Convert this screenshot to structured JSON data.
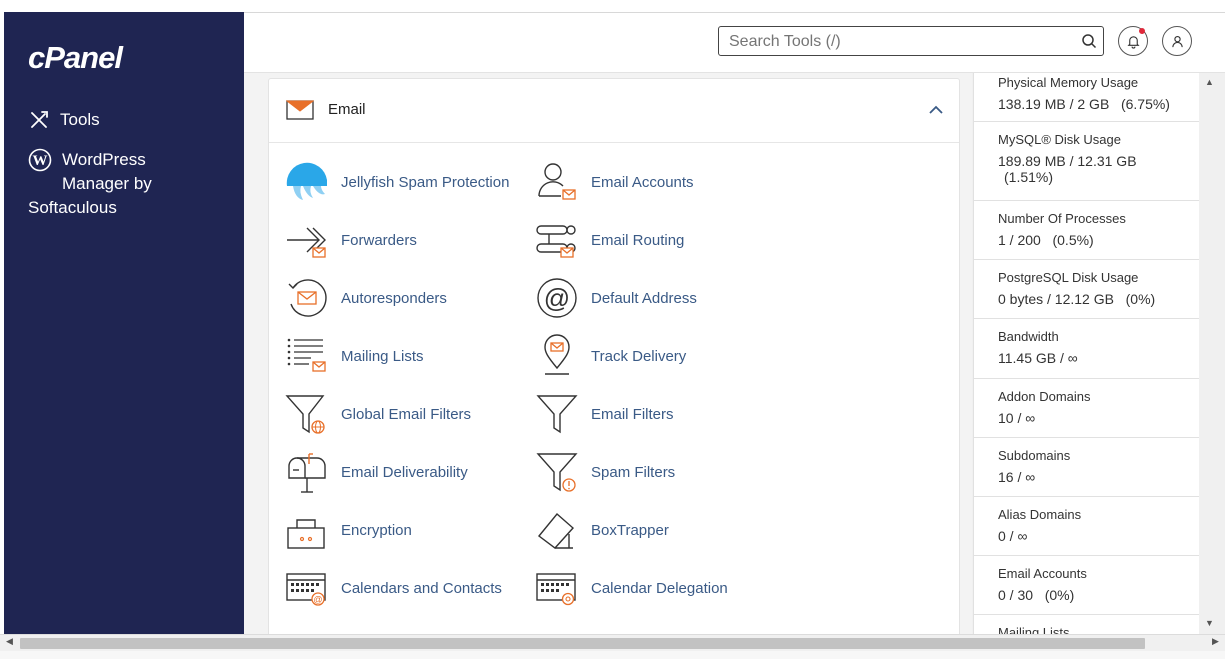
{
  "sidebar": {
    "logo": "cPanel",
    "items": [
      {
        "label": "Tools",
        "icon": "tools-icon"
      },
      {
        "label_lines": [
          "WordPress",
          "Manager by",
          "Softaculous"
        ],
        "icon": "wordpress-icon"
      }
    ]
  },
  "header": {
    "search": {
      "placeholder": "Search Tools (/)",
      "value": ""
    },
    "notifications_icon": "bell-icon",
    "user_icon": "user-icon"
  },
  "email_section": {
    "title": "Email",
    "icon": "envelope-icon",
    "tools": [
      {
        "label": "Jellyfish Spam Protection",
        "icon": "jellyfish-icon"
      },
      {
        "label": "Email Accounts",
        "icon": "email-accounts-icon"
      },
      {
        "label": "Forwarders",
        "icon": "forwarders-icon"
      },
      {
        "label": "Email Routing",
        "icon": "email-routing-icon"
      },
      {
        "label": "Autoresponders",
        "icon": "autoresponders-icon"
      },
      {
        "label": "Default Address",
        "icon": "at-sign-icon"
      },
      {
        "label": "Mailing Lists",
        "icon": "mailing-lists-icon"
      },
      {
        "label": "Track Delivery",
        "icon": "track-delivery-icon"
      },
      {
        "label": "Global Email Filters",
        "icon": "global-filter-icon"
      },
      {
        "label": "Email Filters",
        "icon": "filter-icon"
      },
      {
        "label": "Email Deliverability",
        "icon": "mailbox-icon"
      },
      {
        "label": "Spam Filters",
        "icon": "spam-filter-icon"
      },
      {
        "label": "Encryption",
        "icon": "encryption-icon"
      },
      {
        "label": "BoxTrapper",
        "icon": "boxtrapper-icon"
      },
      {
        "label": "Calendars and Contacts",
        "icon": "calendar-contacts-icon"
      },
      {
        "label": "Calendar Delegation",
        "icon": "calendar-delegation-icon"
      }
    ]
  },
  "stats": [
    {
      "label": "Physical Memory Usage",
      "value": "138.19 MB / 2 GB   (6.75%)"
    },
    {
      "label": "MySQL® Disk Usage",
      "value": "189.89 MB / 12.31 GB",
      "value2": "(1.51%)"
    },
    {
      "label": "Number Of Processes",
      "value": "1 / 200   (0.5%)"
    },
    {
      "label": "PostgreSQL Disk Usage",
      "value": "0 bytes / 12.12 GB   (0%)"
    },
    {
      "label": "Bandwidth",
      "value": "11.45 GB / ∞"
    },
    {
      "label": "Addon Domains",
      "value": "10 / ∞"
    },
    {
      "label": "Subdomains",
      "value": "16 / ∞"
    },
    {
      "label": "Alias Domains",
      "value": "0 / ∞"
    },
    {
      "label": "Email Accounts",
      "value": "0 / 30   (0%)"
    },
    {
      "label": "Mailing Lists",
      "value": ""
    }
  ],
  "colors": {
    "sidebar": "#1f2552",
    "accent_orange": "#e8702a",
    "link_blue": "#3a5a86",
    "jellyfish_blue": "#2aa7e8"
  }
}
